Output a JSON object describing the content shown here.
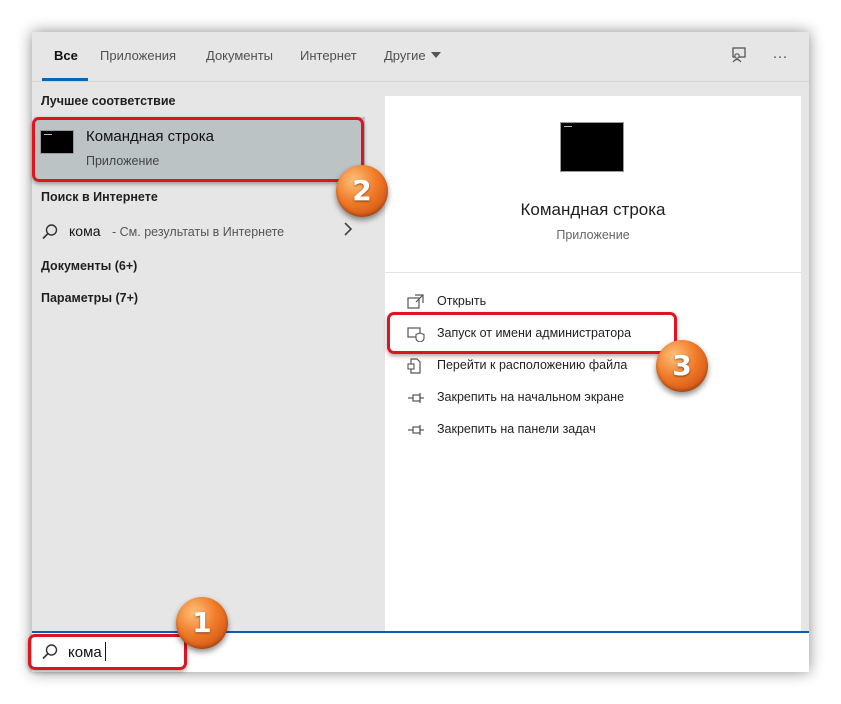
{
  "tabs": [
    {
      "label": "Все"
    },
    {
      "label": "Приложения"
    },
    {
      "label": "Документы"
    },
    {
      "label": "Интернет"
    },
    {
      "label": "Другие"
    }
  ],
  "top_icons": {
    "feedback": "feedback-icon",
    "more": "···"
  },
  "left": {
    "best_match_header": "Лучшее соответствие",
    "best_match": {
      "title": "Командная строка",
      "subtitle": "Приложение"
    },
    "web_header": "Поиск в Интернете",
    "web_result": {
      "query": "кома",
      "hint": "- См. результаты в Интернете"
    },
    "categories": [
      {
        "label": "Документы (6+)"
      },
      {
        "label": "Параметры (7+)"
      }
    ]
  },
  "right": {
    "app_title": "Командная строка",
    "app_type": "Приложение",
    "actions": [
      {
        "label": "Открыть",
        "icon": "open-icon"
      },
      {
        "label": "Запуск от имени администратора",
        "icon": "shield-icon"
      },
      {
        "label": "Перейти к расположению файла",
        "icon": "file-location-icon"
      },
      {
        "label": "Закрепить на начальном экране",
        "icon": "pin-icon"
      },
      {
        "label": "Закрепить на панели задач",
        "icon": "pin-icon"
      }
    ]
  },
  "search": {
    "value": "кома"
  },
  "annotations": {
    "badge1": "1",
    "badge2": "2",
    "badge3": "3",
    "highlight_color": "#e0141e",
    "badge_color": "#f07a28"
  },
  "colors": {
    "accent": "#0067c0",
    "selected_bg": "#bcc3c5",
    "pane_bg": "#e6e6e6"
  }
}
